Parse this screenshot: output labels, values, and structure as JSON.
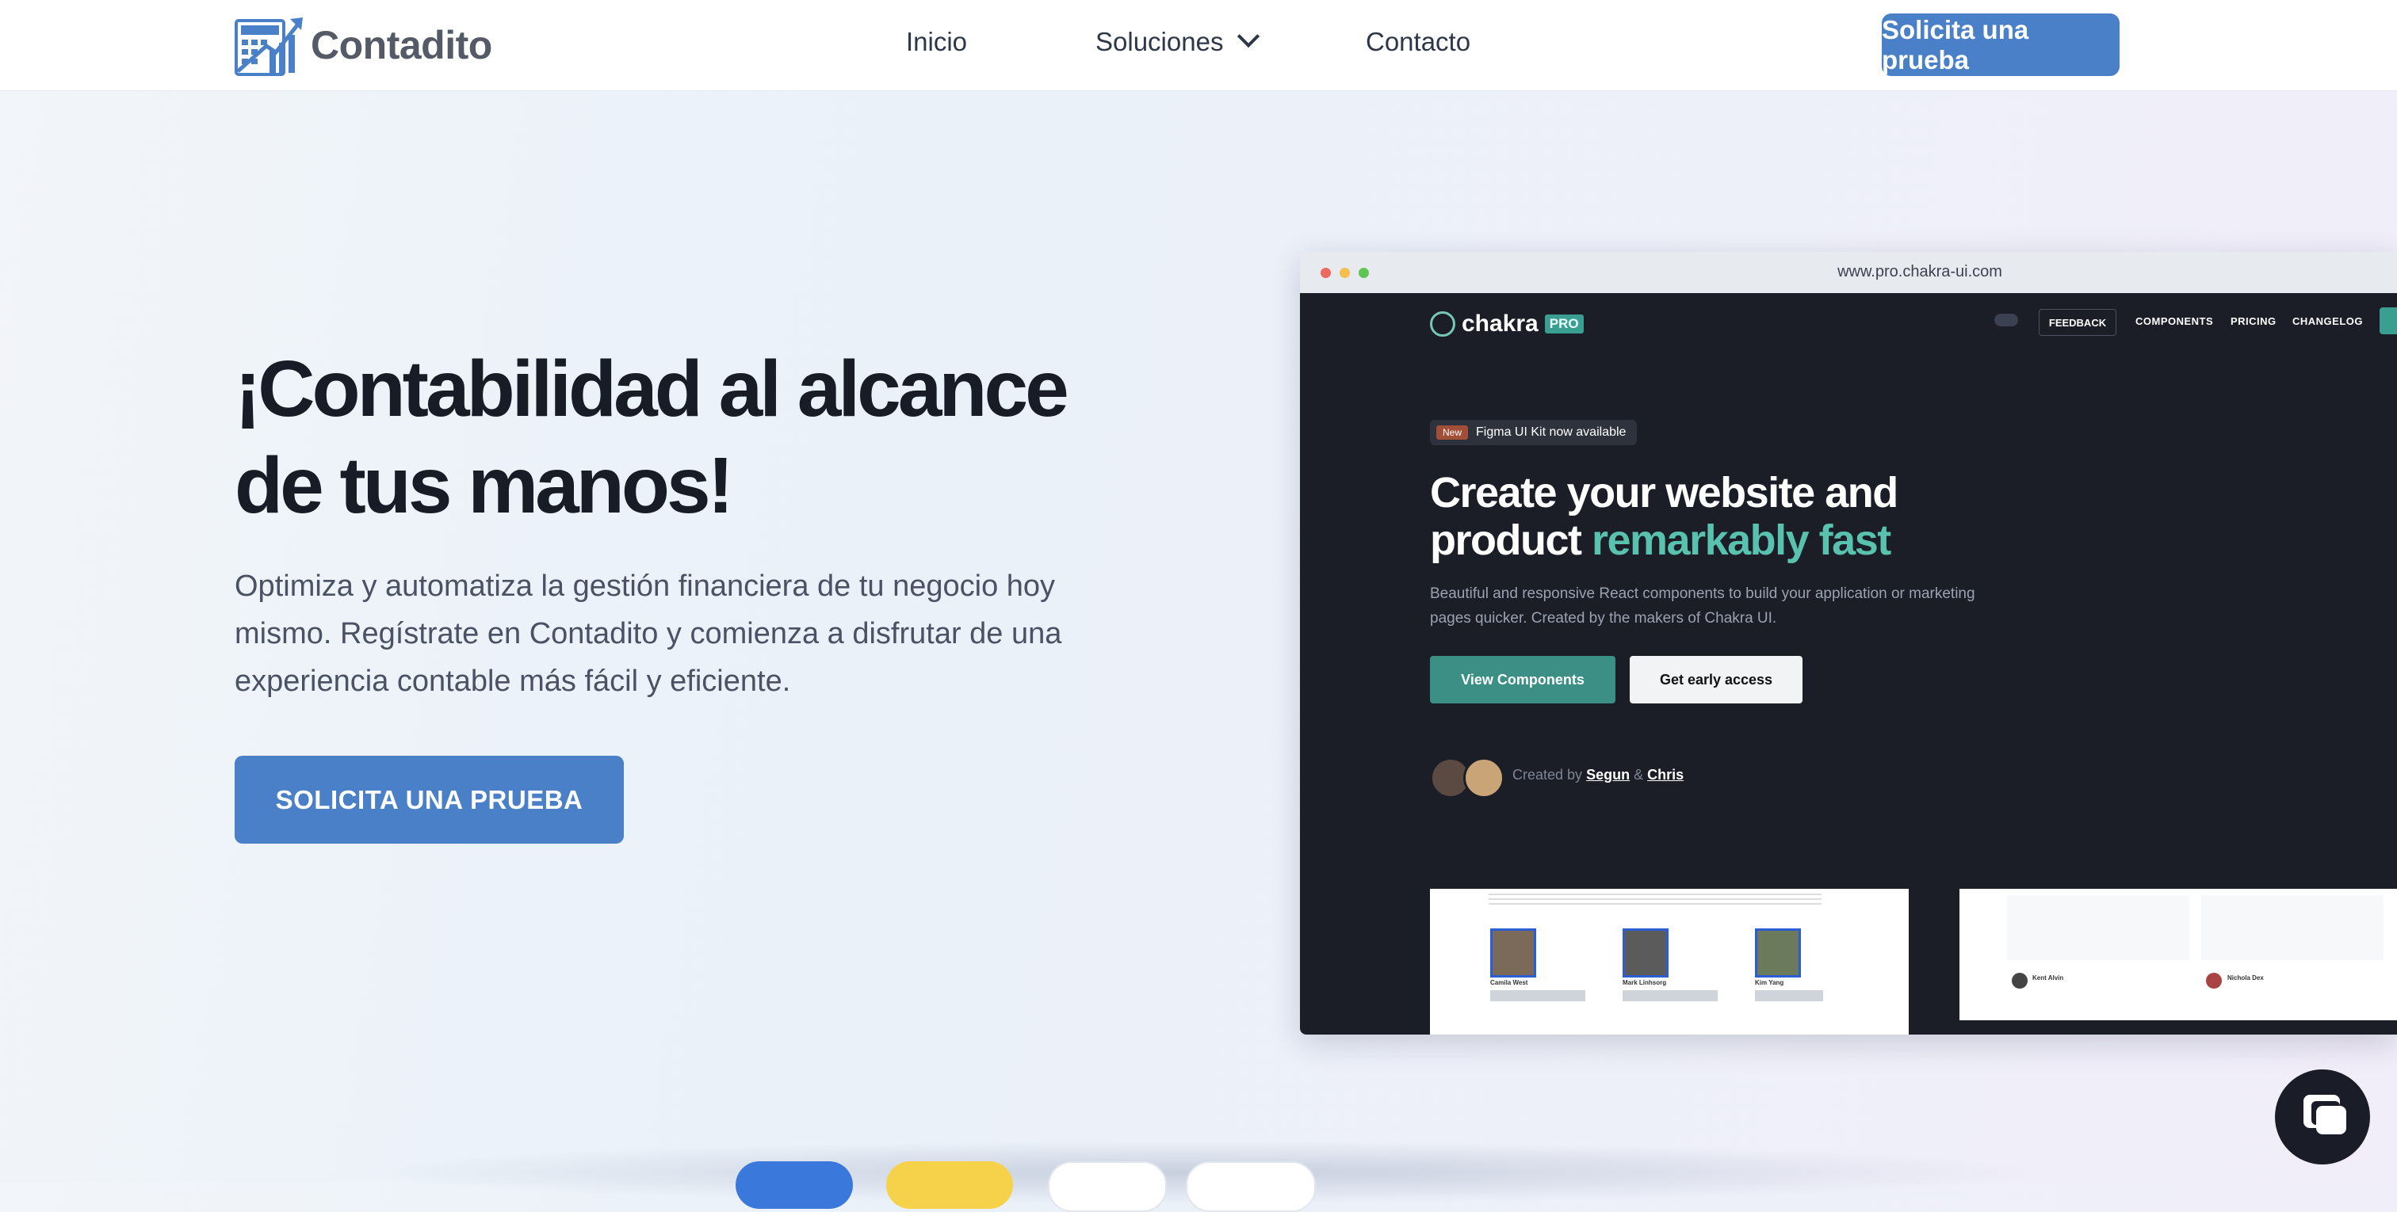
{
  "nav": {
    "brand": "Contadito",
    "links": [
      "Inicio",
      "Soluciones",
      "Contacto"
    ],
    "cta": "Solicita una prueba"
  },
  "hero": {
    "title": "¡Contabilidad al alcance de tus manos!",
    "subtitle": "Optimiza y automatiza la gestión financiera de tu negocio hoy mismo. Regístrate en Contadito y comienza a disfrutar de una experiencia contable más fácil y eficiente.",
    "button": "SOLICITA UNA PRUEBA"
  },
  "mockup": {
    "url": "www.pro.chakra-ui.com",
    "logo": "chakra",
    "logo_badge": "PRO",
    "nav": [
      "FEEDBACK",
      "COMPONENTS",
      "PRICING",
      "CHANGELOG"
    ],
    "badge_new": "New",
    "badge_text": "Figma UI Kit now available",
    "headline": "Create your website and",
    "headline2": "product ",
    "headline_accent": "remarkably fast",
    "desc": "Beautiful and responsive React components to build your application or marketing pages quicker. Created by the makers of Chakra UI.",
    "btn_primary": "View Components",
    "btn_secondary": "Get early access",
    "created_by": "Created by",
    "author1": "Segun",
    "amp": "&",
    "author2": "Chris",
    "team": [
      "Camila West",
      "Mark Linhsorg",
      "Kim Yang"
    ],
    "quote_authors": [
      "Kent Alvin",
      "Nichola Dex"
    ]
  },
  "colors": {
    "primary": "#4a80c8",
    "mockup_bg": "#1b1e27",
    "accent_teal": "#59c2ae"
  }
}
